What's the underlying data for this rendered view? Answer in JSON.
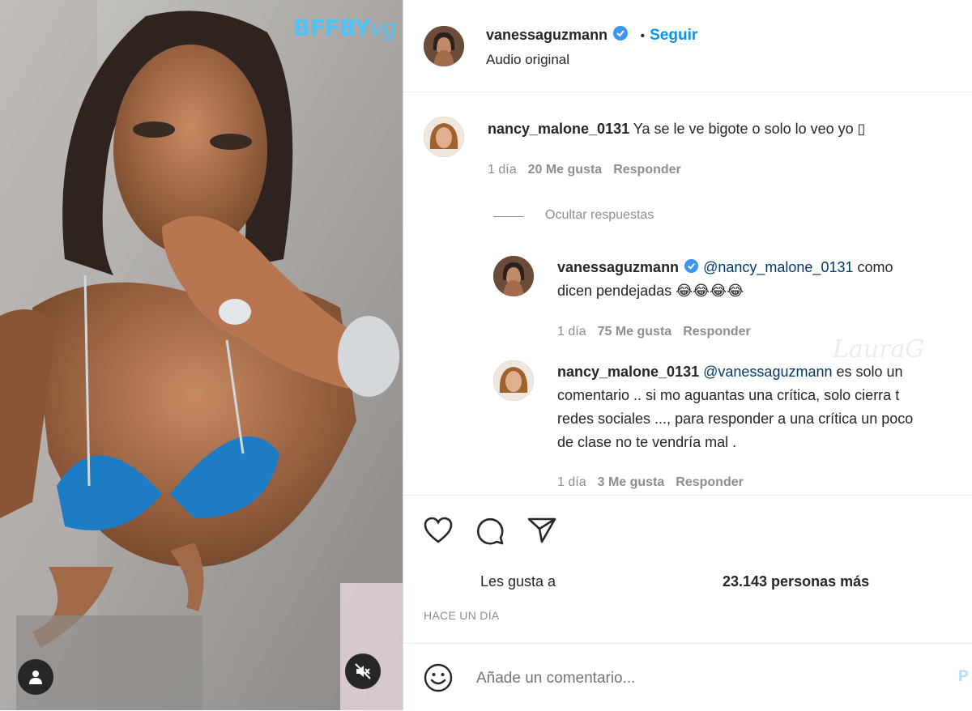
{
  "post": {
    "watermark": "BFFBY",
    "watermark_tail": "vg",
    "user_icon": "user-icon",
    "mute_icon": "speaker-muted-icon"
  },
  "header": {
    "username": "vanessaguzmann",
    "separator": "•",
    "follow_label": "Seguir",
    "subtitle": "Audio original"
  },
  "comments": [
    {
      "username": "nancy_malone_0131",
      "text": "Ya se le ve bigote o solo lo veo yo ▯",
      "time": "1 día",
      "likes": "20 Me gusta",
      "reply_label": "Responder"
    }
  ],
  "hide_replies_label": "Ocultar respuestas",
  "replies": [
    {
      "username": "vanessaguzmann",
      "mention": "@nancy_malone_0131",
      "line1": "como",
      "line2": "dicen pendejadas 😂😂😂😂",
      "time": "1 día",
      "likes": "75 Me gusta",
      "reply_label": "Responder"
    },
    {
      "username": "nancy_malone_0131",
      "mention": "@vanessaguzmann",
      "line1": "es solo un",
      "line2": "comentario .. si mo aguantas una crítica, solo cierra t",
      "line3": "redes sociales ..., para responder a una crítica un poco",
      "line4": "de clase no te vendría mal .",
      "time": "1 día",
      "likes": "3 Me gusta",
      "reply_label": "Responder"
    }
  ],
  "actions": {
    "like_icon": "heart-icon",
    "comment_icon": "comment-icon",
    "share_icon": "send-icon",
    "likes_prefix": "Les gusta a",
    "likes_count": "23.143 personas más",
    "date": "HACE UN DÍA"
  },
  "add_comment": {
    "emoji_icon": "emoji-icon",
    "placeholder": "Añade un comentario...",
    "post_label": "P"
  },
  "watermark2": "LauraG"
}
